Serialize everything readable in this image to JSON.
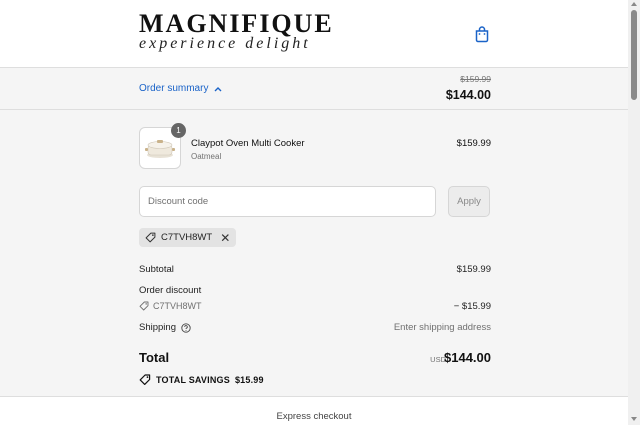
{
  "header": {
    "logo_main": "MAGNIFIQUE",
    "logo_sub": "experience delight",
    "cart_icon": "shopping-bag-icon"
  },
  "summary_bar": {
    "toggle_label": "Order summary",
    "original_price": "$159.99",
    "total_price": "$144.00"
  },
  "product": {
    "name": "Claypot Oven Multi Cooker",
    "variant": "Oatmeal",
    "quantity": "1",
    "price": "$159.99"
  },
  "discount": {
    "placeholder": "Discount code",
    "apply_label": "Apply",
    "applied_code": "C7TVH8WT"
  },
  "totals": {
    "subtotal_label": "Subtotal",
    "subtotal_value": "$159.99",
    "order_discount_label": "Order discount",
    "discount_code": "C7TVH8WT",
    "discount_value": "− $15.99",
    "shipping_label": "Shipping",
    "shipping_value": "Enter shipping address",
    "total_label": "Total",
    "currency": "USD",
    "total_value": "$144.00",
    "savings_label": "TOTAL SAVINGS",
    "savings_value": "$15.99"
  },
  "express": {
    "label": "Express checkout"
  },
  "colors": {
    "link": "#1a63c8",
    "panel_bg": "#f5f5f5"
  }
}
